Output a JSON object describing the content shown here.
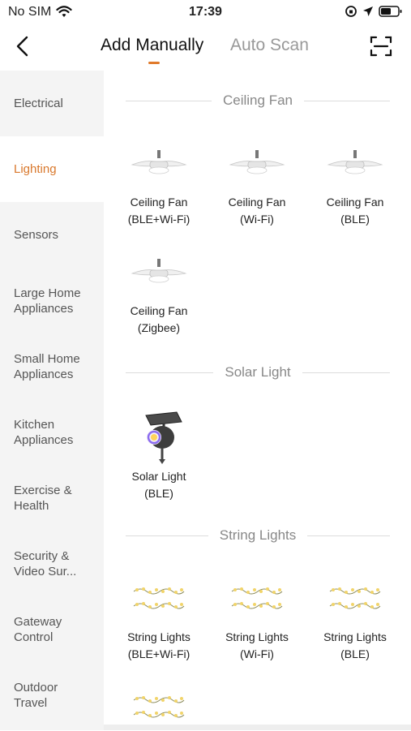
{
  "status": {
    "carrier": "No SIM",
    "time": "17:39"
  },
  "nav": {
    "tab_manual": "Add Manually",
    "tab_auto": "Auto Scan"
  },
  "sidebar": {
    "items": [
      {
        "label": "Electrical",
        "active": false
      },
      {
        "label": "Lighting",
        "active": true
      },
      {
        "label": "Sensors",
        "active": false
      },
      {
        "label": "Large Home Appliances",
        "active": false
      },
      {
        "label": "Small Home Appliances",
        "active": false
      },
      {
        "label": "Kitchen Appliances",
        "active": false
      },
      {
        "label": "Exercise & Health",
        "active": false
      },
      {
        "label": "Security & Video Sur...",
        "active": false
      },
      {
        "label": "Gateway Control",
        "active": false
      },
      {
        "label": "Outdoor Travel",
        "active": false
      }
    ]
  },
  "sections": [
    {
      "title": "Ceiling Fan",
      "devices": [
        {
          "line1": "Ceiling Fan",
          "line2": "(BLE+Wi-Fi)",
          "icon": "ceiling-fan-icon"
        },
        {
          "line1": "Ceiling Fan",
          "line2": "(Wi-Fi)",
          "icon": "ceiling-fan-icon"
        },
        {
          "line1": "Ceiling Fan",
          "line2": "(BLE)",
          "icon": "ceiling-fan-icon"
        },
        {
          "line1": "Ceiling Fan",
          "line2": "(Zigbee)",
          "icon": "ceiling-fan-icon"
        }
      ]
    },
    {
      "title": "Solar Light",
      "devices": [
        {
          "line1": "Solar Light",
          "line2": "(BLE)",
          "icon": "solar-light-icon"
        }
      ]
    },
    {
      "title": "String Lights",
      "devices": [
        {
          "line1": "String Lights",
          "line2": "(BLE+Wi-Fi)",
          "icon": "string-lights-icon"
        },
        {
          "line1": "String Lights",
          "line2": "(Wi-Fi)",
          "icon": "string-lights-icon"
        },
        {
          "line1": "String Lights",
          "line2": "(BLE)",
          "icon": "string-lights-icon"
        }
      ]
    }
  ],
  "colors": {
    "accent": "#e07a2b",
    "sidebar_bg": "#f4f4f4",
    "muted_text": "#888888"
  }
}
